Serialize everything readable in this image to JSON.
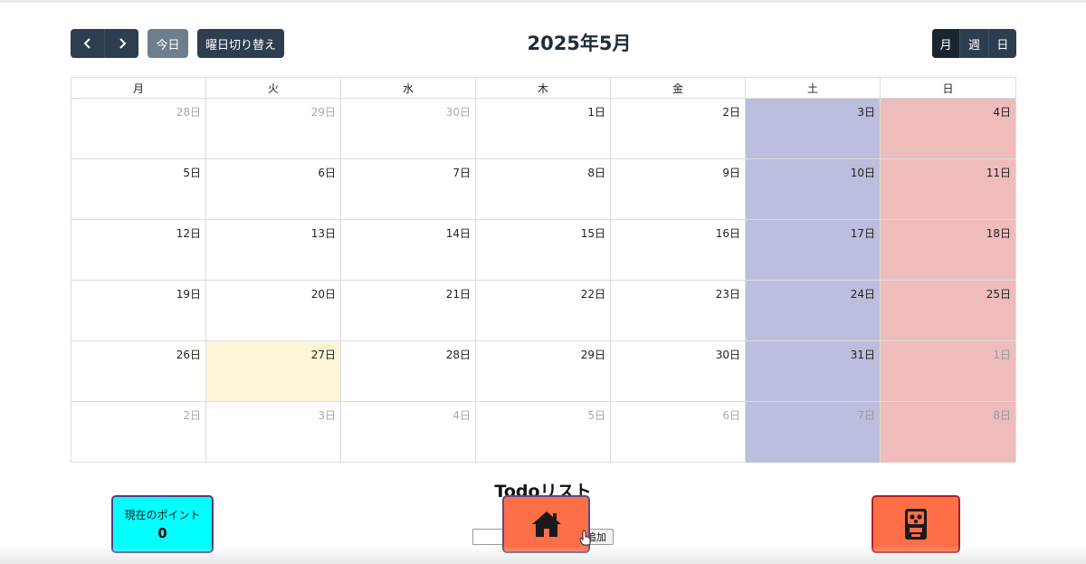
{
  "toolbar": {
    "today_label": "今日",
    "weekday_toggle_label": "曜日切り替え",
    "title": "2025年5月",
    "views": [
      {
        "label": "月",
        "active": true
      },
      {
        "label": "週",
        "active": false
      },
      {
        "label": "日",
        "active": false
      }
    ]
  },
  "calendar": {
    "weekdays": [
      "月",
      "火",
      "水",
      "木",
      "金",
      "土",
      "日"
    ],
    "weeks": [
      [
        {
          "label": "28日",
          "current_month": false,
          "today": false
        },
        {
          "label": "29日",
          "current_month": false,
          "today": false
        },
        {
          "label": "30日",
          "current_month": false,
          "today": false
        },
        {
          "label": "1日",
          "current_month": true,
          "today": false
        },
        {
          "label": "2日",
          "current_month": true,
          "today": false
        },
        {
          "label": "3日",
          "current_month": true,
          "today": false
        },
        {
          "label": "4日",
          "current_month": true,
          "today": false
        }
      ],
      [
        {
          "label": "5日",
          "current_month": true,
          "today": false
        },
        {
          "label": "6日",
          "current_month": true,
          "today": false
        },
        {
          "label": "7日",
          "current_month": true,
          "today": false
        },
        {
          "label": "8日",
          "current_month": true,
          "today": false
        },
        {
          "label": "9日",
          "current_month": true,
          "today": false
        },
        {
          "label": "10日",
          "current_month": true,
          "today": false
        },
        {
          "label": "11日",
          "current_month": true,
          "today": false
        }
      ],
      [
        {
          "label": "12日",
          "current_month": true,
          "today": false
        },
        {
          "label": "13日",
          "current_month": true,
          "today": false
        },
        {
          "label": "14日",
          "current_month": true,
          "today": false
        },
        {
          "label": "15日",
          "current_month": true,
          "today": false
        },
        {
          "label": "16日",
          "current_month": true,
          "today": false
        },
        {
          "label": "17日",
          "current_month": true,
          "today": false
        },
        {
          "label": "18日",
          "current_month": true,
          "today": false
        }
      ],
      [
        {
          "label": "19日",
          "current_month": true,
          "today": false
        },
        {
          "label": "20日",
          "current_month": true,
          "today": false
        },
        {
          "label": "21日",
          "current_month": true,
          "today": false
        },
        {
          "label": "22日",
          "current_month": true,
          "today": false
        },
        {
          "label": "23日",
          "current_month": true,
          "today": false
        },
        {
          "label": "24日",
          "current_month": true,
          "today": false
        },
        {
          "label": "25日",
          "current_month": true,
          "today": false
        }
      ],
      [
        {
          "label": "26日",
          "current_month": true,
          "today": false
        },
        {
          "label": "27日",
          "current_month": true,
          "today": true
        },
        {
          "label": "28日",
          "current_month": true,
          "today": false
        },
        {
          "label": "29日",
          "current_month": true,
          "today": false
        },
        {
          "label": "30日",
          "current_month": true,
          "today": false
        },
        {
          "label": "31日",
          "current_month": true,
          "today": false
        },
        {
          "label": "1日",
          "current_month": false,
          "today": false
        }
      ],
      [
        {
          "label": "2日",
          "current_month": false,
          "today": false
        },
        {
          "label": "3日",
          "current_month": false,
          "today": false
        },
        {
          "label": "4日",
          "current_month": false,
          "today": false
        },
        {
          "label": "5日",
          "current_month": false,
          "today": false
        },
        {
          "label": "6日",
          "current_month": false,
          "today": false
        },
        {
          "label": "7日",
          "current_month": false,
          "today": false
        },
        {
          "label": "8日",
          "current_month": false,
          "today": false
        }
      ]
    ]
  },
  "todo": {
    "title": "Todoリスト",
    "input_value": "",
    "add_label": "追加"
  },
  "points": {
    "label": "現在のポイント",
    "value": "0"
  },
  "icons": {
    "prev": "chevron-left-icon",
    "next": "chevron-right-icon",
    "home": "home-icon",
    "gacha": "gacha-machine-icon"
  },
  "colors": {
    "toolbar_bg": "#2c3e50",
    "saturday_bg": "#bcbedd",
    "sunday_bg": "#efbcbc",
    "today_bg": "#fdf5d8",
    "points_bg": "#00ffff",
    "action_bg": "#ff6f47"
  }
}
